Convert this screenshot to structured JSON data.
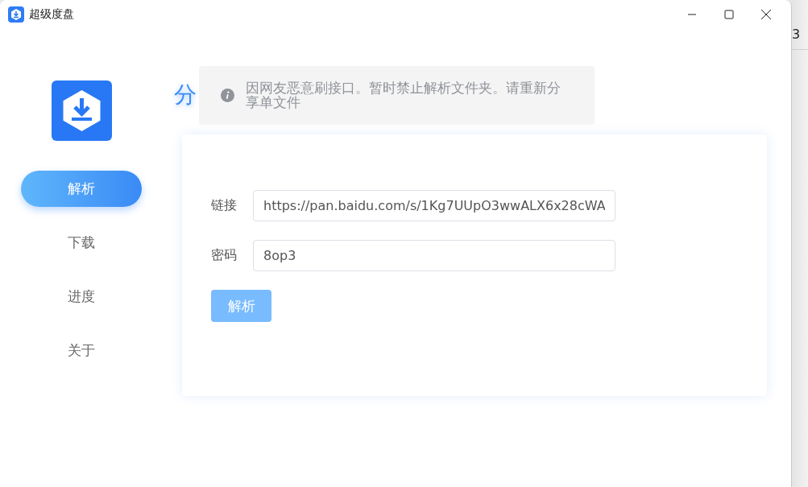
{
  "window": {
    "title": "超级度盘"
  },
  "sidebar": {
    "items": [
      {
        "label": "解析",
        "selected": true
      },
      {
        "label": "下载",
        "selected": false
      },
      {
        "label": "进度",
        "selected": false
      },
      {
        "label": "关于",
        "selected": false
      }
    ]
  },
  "page": {
    "heading": "分"
  },
  "notice": {
    "kind": "info",
    "text": "因网友恶意刷接口。暂时禁止解析文件夹。请重新分享单文件"
  },
  "form": {
    "fields": [
      {
        "label": "链接",
        "value": "https://pan.baidu.com/s/1Kg7UUpO3wwALX6x28cWA"
      },
      {
        "label": "密码",
        "value": "8op3"
      }
    ],
    "submit": "解析"
  },
  "background_window": {
    "text": "3"
  }
}
